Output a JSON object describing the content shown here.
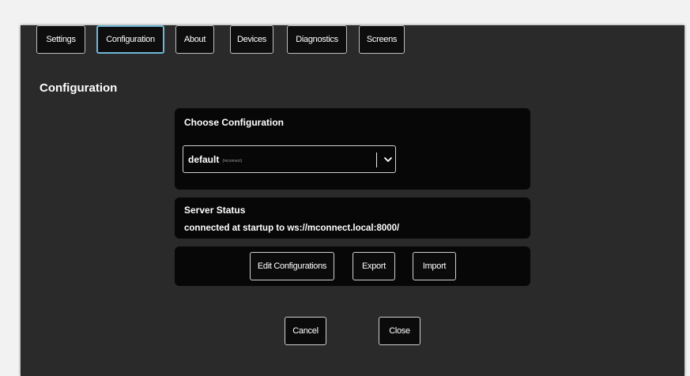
{
  "tabs": [
    {
      "label": "Settings",
      "active": false
    },
    {
      "label": "Configuration",
      "active": true
    },
    {
      "label": "About",
      "active": false
    },
    {
      "label": "Devices",
      "active": false
    },
    {
      "label": "Diagnostics",
      "active": false
    },
    {
      "label": "Screens",
      "active": false
    }
  ],
  "page_title": "Configuration",
  "choose_config": {
    "title": "Choose Configuration",
    "selected_value": "default",
    "selected_sub": "(mconnect)",
    "icon": "chevron-down-icon"
  },
  "server_status": {
    "title": "Server Status",
    "text": "connected at startup to ws://mconnect.local:8000/"
  },
  "actions": {
    "edit_label": "Edit Configurations",
    "export_label": "Export",
    "import_label": "Import"
  },
  "footer": {
    "cancel_label": "Cancel",
    "close_label": "Close"
  },
  "colors": {
    "dialog_bg": "#2a2a2a",
    "panel_bg": "#070707",
    "active_tab_border": "#6fb7d6",
    "text": "#ffffff"
  }
}
